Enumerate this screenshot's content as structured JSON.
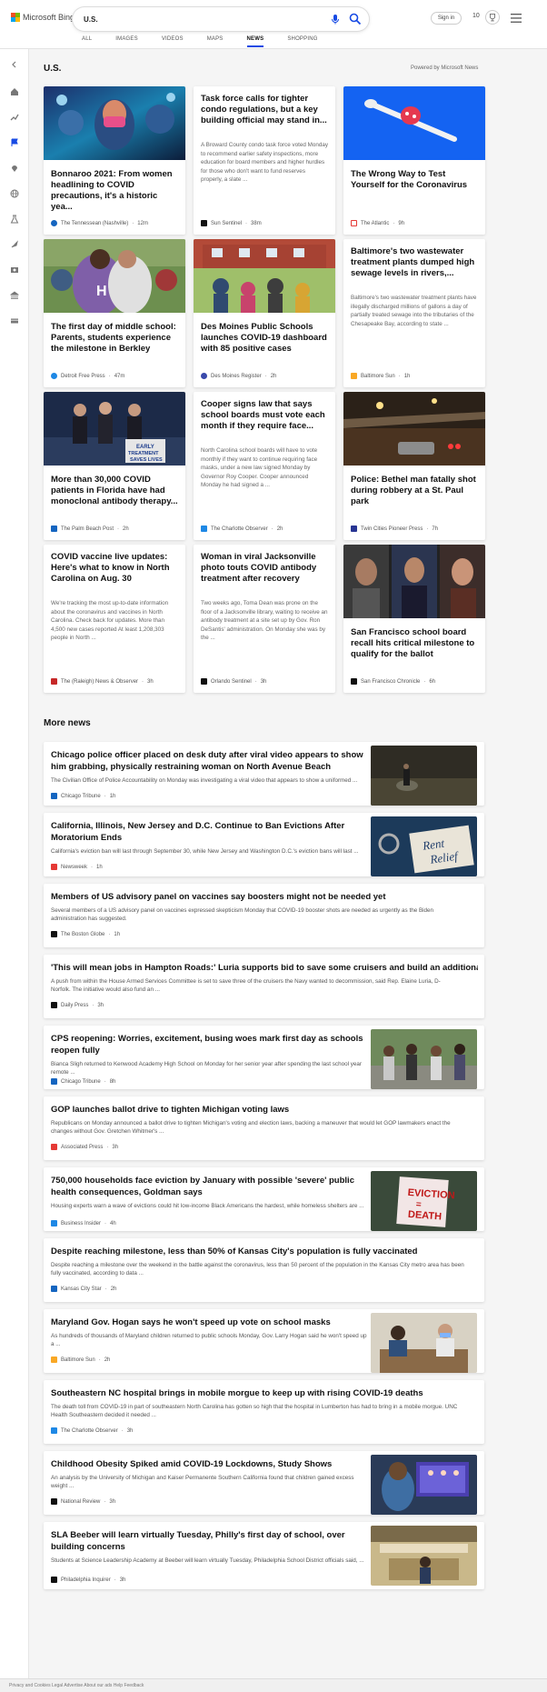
{
  "header": {
    "logo_text": "Microsoft Bing",
    "search_value": "U.S.",
    "signin_label": "Sign in",
    "points": "10",
    "nav_tabs": [
      "ALL",
      "IMAGES",
      "VIDEOS",
      "MAPS",
      "NEWS",
      "SHOPPING"
    ],
    "active_tab": "NEWS"
  },
  "section": {
    "title": "U.S.",
    "powered_by": "Powered by Microsoft News"
  },
  "cards": [
    {
      "title": "Bonnaroo 2021: From women headlining to COVID precautions, it's a historic yea...",
      "snippet": "",
      "source": "The Tennessean (Nashville)",
      "time": "12m",
      "image": "crowd-photo",
      "logo_color": "#1565c0"
    },
    {
      "title": "Task force calls for tighter condo regulations, but a key building official may stand in...",
      "snippet": "A Broward County condo task force voted Monday to recommend earlier safety inspections, more education for board members and higher hurdles for those who don't want to fund reserves properly, a slate ...",
      "source": "Sun Sentinel",
      "time": "38m",
      "image": "",
      "logo_color": "#111111"
    },
    {
      "title": "The Wrong Way to Test Yourself for the Coronavirus",
      "snippet": "",
      "source": "The Atlantic",
      "time": "9h",
      "image": "swab-photo",
      "logo_color": "#e53935"
    },
    {
      "title": "The first day of middle school: Parents, students experience the milestone in Berkley",
      "snippet": "",
      "source": "Detroit Free Press",
      "time": "47m",
      "image": "hug-photo",
      "logo_color": "#1e88e5"
    },
    {
      "title": "Des Moines Public Schools launches COVID-19 dashboard with 85 positive cases",
      "snippet": "",
      "source": "Des Moines Register",
      "time": "2h",
      "image": "school-photo",
      "logo_color": "#3949ab"
    },
    {
      "title": "Baltimore's two wastewater treatment plants dumped high sewage levels in rivers,...",
      "snippet": "Baltimore's two wastewater treatment plants have illegally discharged millions of gallons a day of partially treated sewage into the tributaries of the Chesapeake Bay, according to state ...",
      "source": "Baltimore Sun",
      "time": "1h",
      "image": "",
      "logo_color": "#f9a825"
    },
    {
      "title": "More than 30,000 COVID patients in Florida have had monoclonal antibody therapy...",
      "snippet": "",
      "source": "The Palm Beach Post",
      "time": "2h",
      "image": "podium-photo",
      "logo_color": "#1565c0"
    },
    {
      "title": "Cooper signs law that says school boards must vote each month if they require face...",
      "snippet": "North Carolina school boards will have to vote monthly if they want to continue requiring face masks, under a new law signed Monday by Governor Roy Cooper. Cooper announced Monday he had signed a ...",
      "source": "The Charlotte Observer",
      "time": "2h",
      "image": "",
      "logo_color": "#1e88e5"
    },
    {
      "title": "Police: Bethel man fatally shot during robbery at a St. Paul park",
      "snippet": "",
      "source": "Twin Cities Pioneer Press",
      "time": "7h",
      "image": "night-photo",
      "logo_color": "#283593"
    },
    {
      "title": "COVID vaccine live updates: Here's what to know in North Carolina on Aug. 30",
      "snippet": "We're tracking the most up-to-date information about the coronavirus and vaccines in North Carolina. Check back for updates. More than 4,500 new cases reported At least 1,208,303 people in North ...",
      "source": "The (Raleigh) News & Observer",
      "time": "3h",
      "image": "",
      "logo_color": "#c62828"
    },
    {
      "title": "Woman in viral Jacksonville photo touts COVID antibody treatment after recovery",
      "snippet": "Two weeks ago, Toma Dean was prone on the floor of a Jacksonville library, waiting to receive an antibody treatment at a site set up by Gov. Ron DeSantis' administration. On Monday she was by the ...",
      "source": "Orlando Sentinel",
      "time": "3h",
      "image": "",
      "logo_color": "#111111"
    },
    {
      "title": "San Francisco school board recall hits critical milestone to qualify for the ballot",
      "snippet": "",
      "source": "San Francisco Chronicle",
      "time": "6h",
      "image": "portraits-photo",
      "logo_color": "#111111"
    }
  ],
  "more_news": {
    "title": "More news",
    "items": [
      {
        "title": "Chicago police officer placed on desk duty after viral video appears to show him grabbing, physically restraining woman on North Avenue Beach",
        "snippet": "The Civilian Office of Police Accountability on Monday was investigating a viral video that appears to show a uniformed ...",
        "source": "Chicago Tribune",
        "time": "1h",
        "thumb": "beach-night",
        "logo_color": "#1565c0"
      },
      {
        "title": "California, Illinois, New Jersey and D.C. Continue to Ban Evictions After Moratorium Ends",
        "snippet": "California's eviction ban will last through September 30, while New Jersey and Washington D.C.'s eviction bans will last ...",
        "source": "Newsweek",
        "time": "1h",
        "thumb": "rent-relief",
        "logo_color": "#e53935"
      },
      {
        "title": "Members of US advisory panel on vaccines say boosters might not be needed yet",
        "snippet": "Several members of a US advisory panel on vaccines expressed skepticism Monday that COVID-19 booster shots are needed as urgently as the Biden administration has suggested.",
        "source": "The Boston Globe",
        "time": "1h",
        "thumb": "",
        "logo_color": "#111111"
      },
      {
        "title": "'This will mean jobs in Hampton Roads:' Luria supports bid to save some cruisers and build an additional sub",
        "snippet": "A push from within the House Armed Services Committee is set to save three of the cruisers the Navy wanted to decommission, said Rep. Elaine Luria, D-Norfolk. The initiative would also fund an ...",
        "source": "Daily Press",
        "time": "3h",
        "thumb": "",
        "logo_color": "#111111"
      },
      {
        "title": "CPS reopening: Worries, excitement, busing woes mark first day as schools reopen fully",
        "snippet": "Bianca Sligh returned to Kenwood Academy High School on Monday for her senior year after spending the last school year remote ...",
        "source": "Chicago Tribune",
        "time": "8h",
        "thumb": "crowd-street",
        "logo_color": "#1565c0"
      },
      {
        "title": "GOP launches ballot drive to tighten Michigan voting laws",
        "snippet": "Republicans on Monday announced a ballot drive to tighten Michigan's voting and election laws, backing a maneuver that would let GOP lawmakers enact the changes without Gov. Gretchen Whitmer's ...",
        "source": "Associated Press",
        "time": "3h",
        "thumb": "",
        "logo_color": "#e53935"
      },
      {
        "title": "750,000 households face eviction by January with possible 'severe' public health consequences, Goldman says",
        "snippet": "Housing experts warn a wave of evictions could hit low-income Black Americans the hardest, while homeless shelters are ...",
        "source": "Business Insider",
        "time": "4h",
        "thumb": "eviction-sign",
        "logo_color": "#1e88e5"
      },
      {
        "title": "Despite reaching milestone, less than 50% of Kansas City's population is fully vaccinated",
        "snippet": "Despite reaching a milestone over the weekend in the battle against the coronavirus, less than 50 percent of the population in the Kansas City metro area has been fully vaccinated, according to data ...",
        "source": "Kansas City Star",
        "time": "2h",
        "thumb": "",
        "logo_color": "#1565c0"
      },
      {
        "title": "Maryland Gov. Hogan says he won't speed up vote on school masks",
        "snippet": "As hundreds of thousands of Maryland children returned to public schools Monday, Gov. Larry Hogan said he won't speed up a ...",
        "source": "Baltimore Sun",
        "time": "2h",
        "thumb": "classroom",
        "logo_color": "#f9a825"
      },
      {
        "title": "Southeastern NC hospital brings in mobile morgue to keep up with rising COVID-19 deaths",
        "snippet": "The death toll from COVID-19 in part of southeastern North Carolina has gotten so high that the hospital in Lumberton has had to bring in a mobile morgue. UNC Health Southeastern decided it needed ...",
        "source": "The Charlotte Observer",
        "time": "3h",
        "thumb": "",
        "logo_color": "#1e88e5"
      },
      {
        "title": "Childhood Obesity Spiked amid COVID-19 Lockdowns, Study Shows",
        "snippet": "An analysis by the University of Michigan and Kaiser Permanente Southern California found that children gained excess weight ...",
        "source": "National Review",
        "time": "3h",
        "thumb": "child-laptop",
        "logo_color": "#111111"
      },
      {
        "title": "SLA Beeber will learn virtually Tuesday, Philly's first day of school, over building concerns",
        "snippet": "Students at Science Leadership Academy at Beeber will learn virtually Tuesday, Philadelphia School District officials said, ...",
        "source": "Philadelphia Inquirer",
        "time": "3h",
        "thumb": "school-hall",
        "logo_color": "#111111"
      }
    ]
  },
  "footer": {
    "text": "Privacy and Cookies    Legal    Advertise    About our ads    Help    Feedback"
  }
}
